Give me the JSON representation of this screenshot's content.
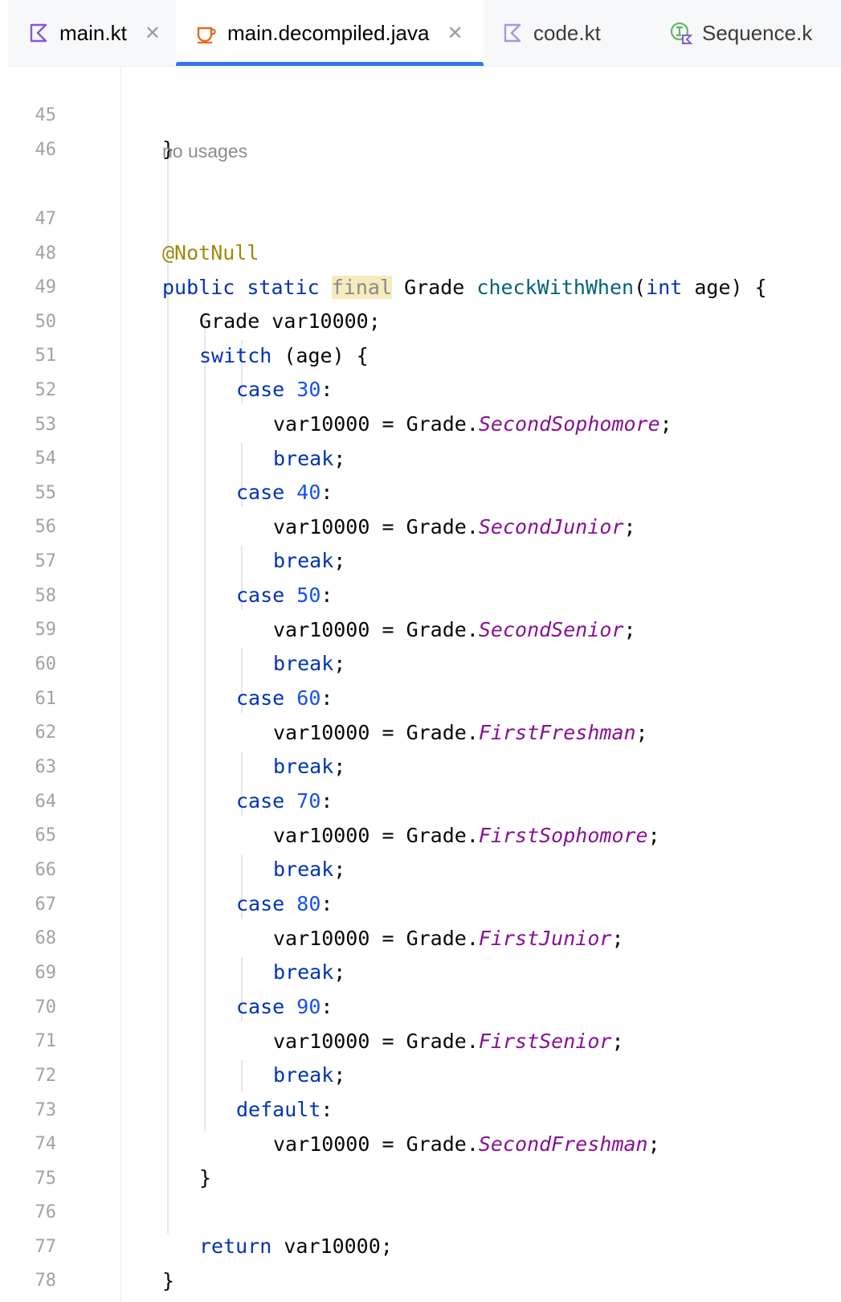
{
  "tabs": [
    {
      "label": "main.kt",
      "icon": "kotlin-file-icon",
      "closable": true,
      "active": false
    },
    {
      "label": "main.decompiled.java",
      "icon": "java-file-icon",
      "closable": true,
      "active": true
    },
    {
      "label": "code.kt",
      "icon": "kotlin-file-icon",
      "closable": false,
      "active": false
    },
    {
      "label": "Sequence.k",
      "icon": "kotlin-interface-icon",
      "closable": false,
      "active": false
    }
  ],
  "accent_color": "#3574f0",
  "editor": {
    "inlay_hint": "no usages",
    "line_numbers": [
      "45",
      "46",
      "47",
      "48",
      "49",
      "50",
      "51",
      "52",
      "53",
      "54",
      "55",
      "56",
      "57",
      "58",
      "59",
      "60",
      "61",
      "62",
      "63",
      "64",
      "65",
      "66",
      "67",
      "68",
      "69",
      "70",
      "71",
      "72",
      "73",
      "74",
      "75",
      "76",
      "77",
      "78"
    ],
    "code": {
      "l45": "}",
      "l47_annotation": "@NotNull",
      "l48_public": "public",
      "l48_static": "static",
      "l48_final": "final",
      "l48_type": "Grade",
      "l48_method": "checkWithWhen",
      "l48_int": "int",
      "l48_rest": " age) {",
      "l49": "Grade var10000;",
      "l50_switch": "switch",
      "l50_rest": " (age) {",
      "case_kw": "case",
      "break_kw": "break",
      "default_kw": "default",
      "return_kw": "return",
      "assign_prefix": "var10000 = Grade.",
      "case_values": [
        "30",
        "40",
        "50",
        "60",
        "70",
        "80",
        "90"
      ],
      "enum_values": [
        "SecondSophomore",
        "SecondJunior",
        "SecondSenior",
        "FirstFreshman",
        "FirstSophomore",
        "FirstJunior",
        "FirstSenior"
      ],
      "default_value": "SecondFreshman",
      "return_rest": " var10000;"
    }
  }
}
